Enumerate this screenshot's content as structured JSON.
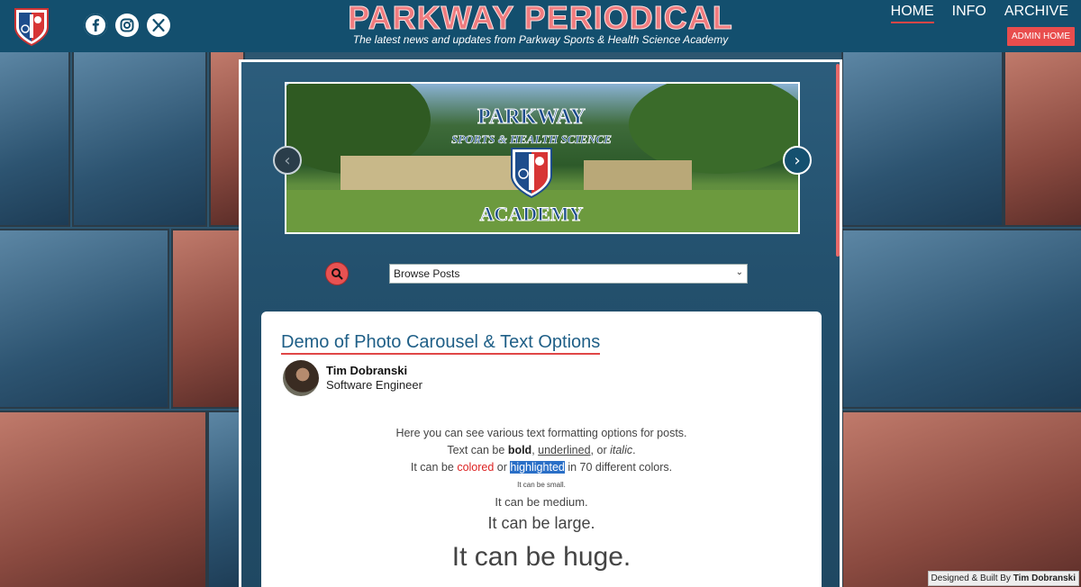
{
  "header": {
    "title": "PARKWAY PERIODICAL",
    "subtitle": "The latest news and updates from Parkway Sports & Health Science Academy",
    "social": [
      "facebook-icon",
      "instagram-icon",
      "x-icon"
    ],
    "nav": [
      {
        "label": "HOME",
        "active": true
      },
      {
        "label": "INFO",
        "active": false
      },
      {
        "label": "ARCHIVE",
        "active": false
      }
    ],
    "admin_label": "ADMIN HOME"
  },
  "carousel": {
    "logo_top": "PARKWAY",
    "logo_mid": "SPORTS & HEALTH SCIENCE",
    "logo_bottom": "ACADEMY"
  },
  "browse": {
    "selected": "Browse Posts"
  },
  "post": {
    "title": "Demo of Photo Carousel & Text Options",
    "author": "Tim Dobranski",
    "role": "Software Engineer",
    "line1": "Here you can see various text formatting options for posts.",
    "line2_prefix": "Text can be ",
    "line2_bold": "bold",
    "line2_sep1": ", ",
    "line2_underlined": "underlined",
    "line2_sep2": ", or ",
    "line2_italic": "italic",
    "line2_end": ".",
    "line3_prefix": "It can be ",
    "line3_colored": "colored",
    "line3_or": " or ",
    "line3_highlighted": "highlighted",
    "line3_end": " in 70 different colors.",
    "small": "It can be small.",
    "medium": "It can be medium.",
    "large": "It can be large.",
    "huge": "It can be huge."
  },
  "footer": {
    "credit_prefix": "Designed & Built By ",
    "credit_name": "Tim Dobranski"
  },
  "colors": {
    "header_bg": "#134f6e",
    "accent_red": "#e04646",
    "title_pink": "#f07c7f",
    "link_blue": "#1f5f87"
  }
}
